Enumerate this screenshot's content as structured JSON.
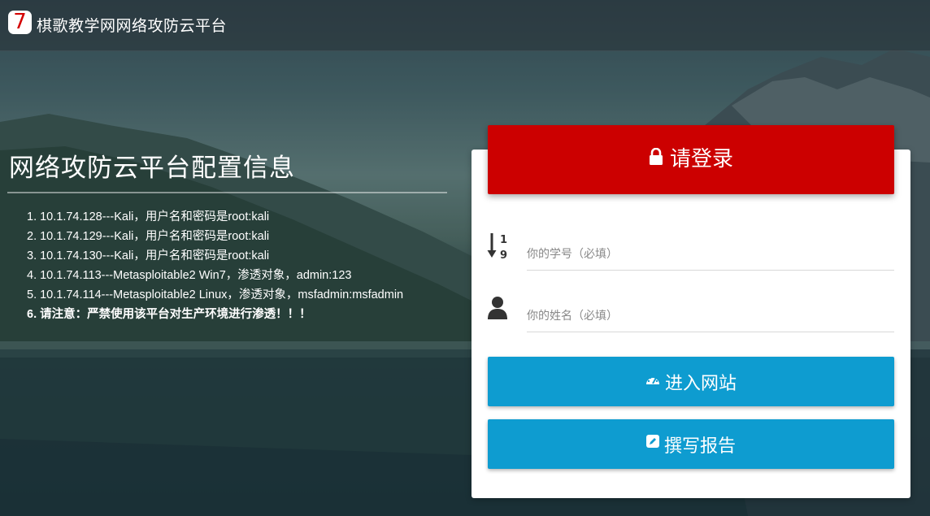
{
  "navbar": {
    "logo_glyph": "7",
    "title": "棋歌教学网网络攻防云平台"
  },
  "info": {
    "title": "网络攻防云平台配置信息",
    "items": [
      "1. 10.1.74.128---Kali，用户名和密码是root:kali",
      "2. 10.1.74.129---Kali，用户名和密码是root:kali",
      "3. 10.1.74.130---Kali，用户名和密码是root:kali",
      "4. 10.1.74.113---Metasploitable2 Win7，渗透对象，admin:123",
      "5. 10.1.74.114---Metasploitable2 Linux，渗透对象，msfadmin:msfadmin"
    ],
    "warning": "6. 请注意：严禁使用该平台对生产环境进行渗透！！！"
  },
  "login": {
    "header_label": "请登录",
    "header_icon": "lock-icon",
    "student_id_placeholder": "你的学号（必填）",
    "student_id_icon": "sort-numeric-icon",
    "name_placeholder": "你的姓名（必填）",
    "name_icon": "user-icon",
    "enter_label": "进入网站",
    "enter_icon": "dashboard-icon",
    "report_label": "撰写报告",
    "report_icon": "edit-icon"
  },
  "colors": {
    "header_red": "#cc0000",
    "button_blue": "#0e9cd0",
    "logo_red": "#d40000"
  }
}
